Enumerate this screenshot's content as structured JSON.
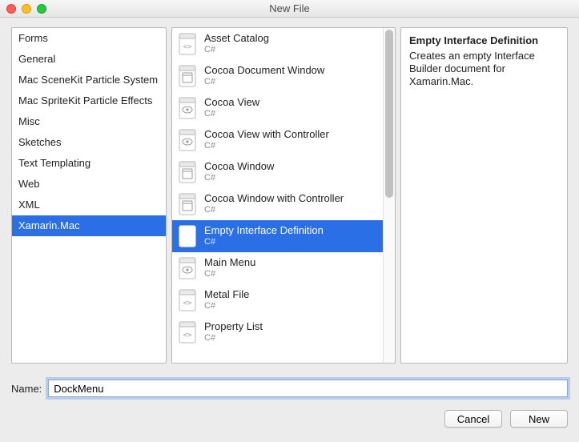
{
  "window": {
    "title": "New File"
  },
  "categories": [
    "Forms",
    "General",
    "Mac SceneKit Particle System",
    "Mac SpriteKit Particle Effects",
    "Misc",
    "Sketches",
    "Text Templating",
    "Web",
    "XML",
    "Xamarin.Mac"
  ],
  "selected_category_index": 9,
  "templates": [
    {
      "label": "Asset Catalog",
      "sub": "C#",
      "icon": "code"
    },
    {
      "label": "Cocoa Document Window",
      "sub": "C#",
      "icon": "window"
    },
    {
      "label": "Cocoa View",
      "sub": "C#",
      "icon": "view"
    },
    {
      "label": "Cocoa View with Controller",
      "sub": "C#",
      "icon": "view"
    },
    {
      "label": "Cocoa Window",
      "sub": "C#",
      "icon": "window"
    },
    {
      "label": "Cocoa Window with Controller",
      "sub": "C#",
      "icon": "window"
    },
    {
      "label": "Empty Interface Definition",
      "sub": "C#",
      "icon": "view"
    },
    {
      "label": "Main Menu",
      "sub": "C#",
      "icon": "view"
    },
    {
      "label": "Metal File",
      "sub": "C#",
      "icon": "code"
    },
    {
      "label": "Property List",
      "sub": "C#",
      "icon": "code"
    }
  ],
  "selected_template_index": 6,
  "description": {
    "title": "Empty Interface Definition",
    "body": "Creates an empty Interface Builder document for Xamarin.Mac."
  },
  "name_field": {
    "label": "Name:",
    "value": "DockMenu"
  },
  "buttons": {
    "cancel": "Cancel",
    "confirm": "New"
  }
}
